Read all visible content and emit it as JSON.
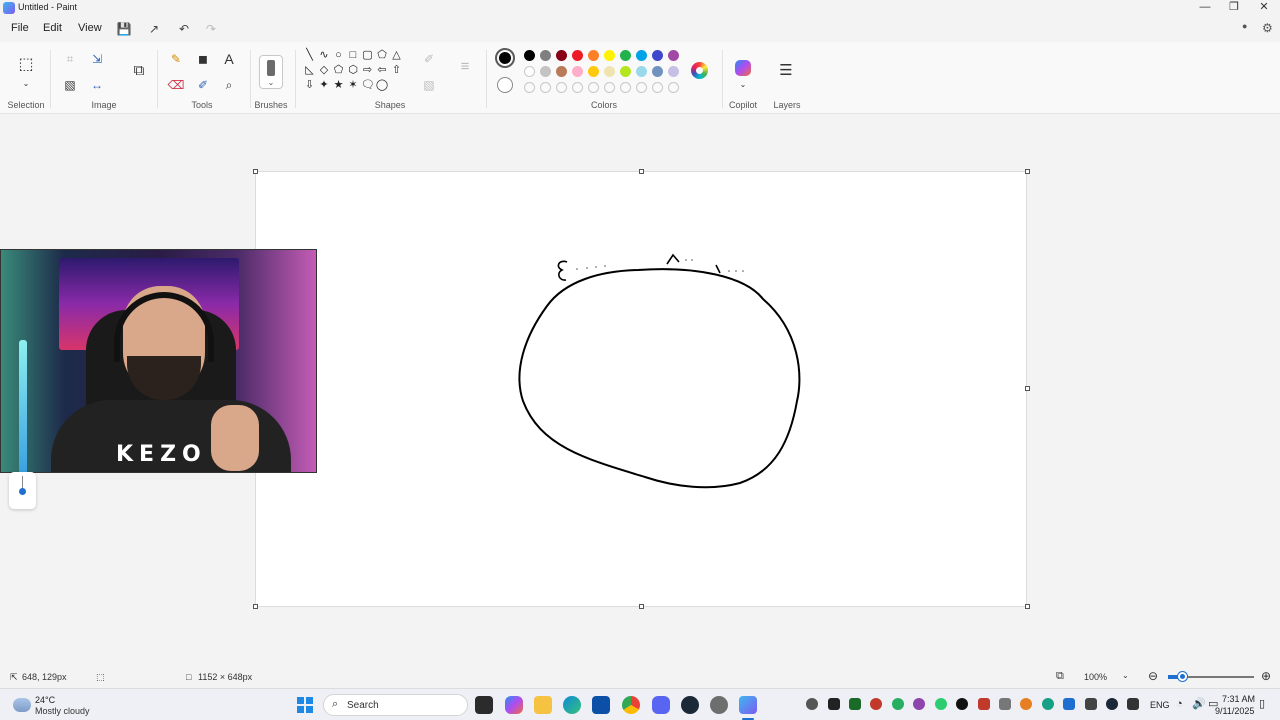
{
  "window": {
    "title": "Untitled - Paint",
    "minimize": "—",
    "maximize": "❐",
    "close": "✕"
  },
  "menu": {
    "file": "File",
    "edit": "Edit",
    "view": "View"
  },
  "quick_access": {
    "save": "💾",
    "share": "↗",
    "undo": "↶",
    "redo": "↷"
  },
  "ribbon": {
    "groups": {
      "selection": "Selection",
      "image": "Image",
      "tools": "Tools",
      "brushes": "Brushes",
      "shapes": "Shapes",
      "colors": "Colors",
      "copilot": "Copilot",
      "layers": "Layers"
    },
    "icons": {
      "select_rect": "⬚",
      "crop": "⌗",
      "resize": "⇲",
      "image_search": "⧉",
      "rotate": "↻",
      "flip": "↔",
      "pencil": "✎",
      "fill": "◼",
      "text": "A",
      "eraser": "⌫",
      "picker": "✐",
      "magnifier": "⌕",
      "outline": "✐",
      "fill_style": "▧",
      "line_width": "≡",
      "layers": "☰",
      "chevron": "⌄"
    },
    "shapes": [
      "╲",
      "∿",
      "○",
      "□",
      "▢",
      "⬠",
      "△",
      "◺",
      "◇",
      "⬠",
      "⬡",
      "⇨",
      "⇦",
      "⇧",
      "⇩",
      "✦",
      "★",
      "✶",
      "🗨",
      "◯"
    ]
  },
  "colors": {
    "current": "#000000",
    "row1": [
      "#000000",
      "#7f7f7f",
      "#880015",
      "#ed1c24",
      "#ff7f27",
      "#fff200",
      "#22b14c",
      "#00a2e8",
      "#3f48cc",
      "#a349a4"
    ],
    "row2": [
      "#ffffff",
      "#c3c3c3",
      "#b97a57",
      "#ffaec9",
      "#ffc90e",
      "#efe4b0",
      "#b5e61d",
      "#99d9ea",
      "#7092be",
      "#c8bfe7"
    ],
    "empty_count": 10
  },
  "status": {
    "cursor_position": "648, 129px",
    "canvas_size": "1152 × 648px",
    "zoom": "100%",
    "zoom_out": "⊖",
    "zoom_in": "⊕",
    "fit": "⧉"
  },
  "webcam": {
    "shirt_text": "KEZO"
  },
  "taskbar": {
    "weather_temp": "24°C",
    "weather_desc": "Mostly cloudy",
    "search_placeholder": "Search",
    "search_icon": "⌕",
    "language": "ENG",
    "time": "7:31 AM",
    "date": "9/11/2025",
    "wifi": "◔",
    "volume": "🔊",
    "battery": "▭"
  }
}
